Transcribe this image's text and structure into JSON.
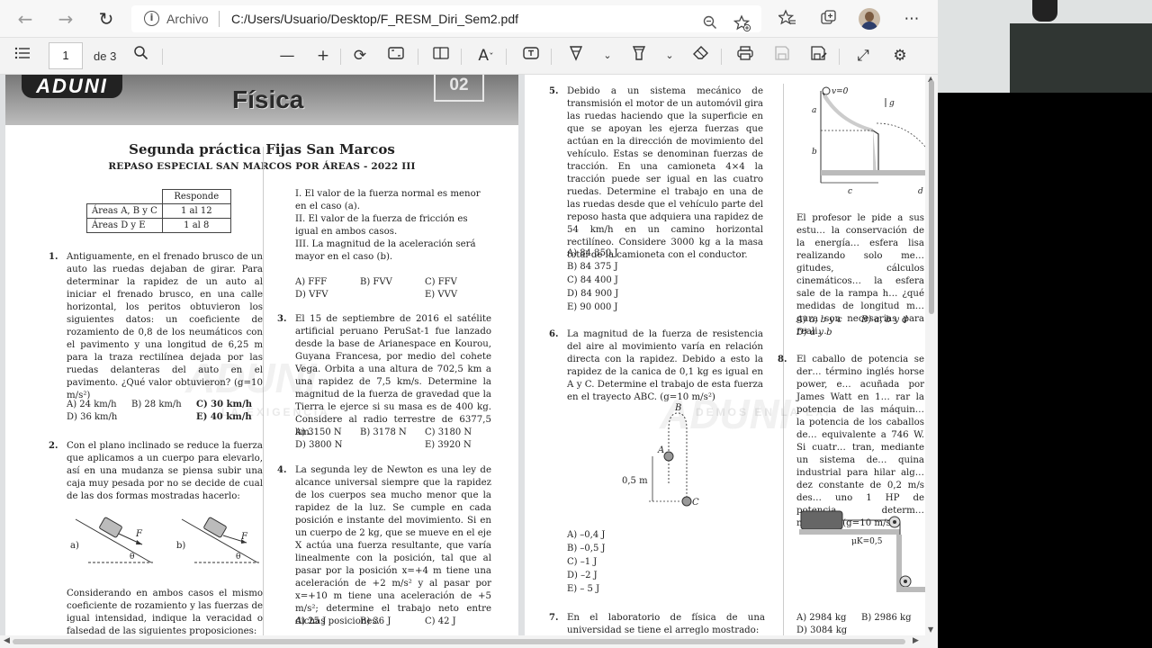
{
  "browser": {
    "site_label": "Archivo",
    "url": "C:/Users/Usuario/Desktop/F_RESM_Diri_Sem2.pdf",
    "icons": [
      "back-icon",
      "forward-icon",
      "refresh-icon",
      "info-icon",
      "zoom-icon",
      "favorite-add-icon",
      "favorites-icon",
      "collections-icon",
      "profile-avatar",
      "more-icon"
    ]
  },
  "pdf_toolbar": {
    "current_page": "1",
    "page_of": "de 3",
    "icons": [
      "contents-icon",
      "search-icon",
      "zoom-out-icon",
      "zoom-in-icon",
      "rotate-icon",
      "fit-page-icon",
      "page-view-icon",
      "read-aloud-icon",
      "text-box-icon",
      "draw-icon",
      "highlight-icon",
      "erase-icon",
      "print-icon",
      "save-icon",
      "save-as-icon",
      "fullscreen-icon",
      "settings-icon"
    ]
  },
  "page1": {
    "logo": "ADUNI",
    "banner_title": "Física",
    "banner_num": "02",
    "title": "Segunda práctica Fijas San Marcos",
    "subtitle": "REPASO ESPECIAL SAN MARCOS POR ÁREAS - 2022 III",
    "table": {
      "header": "Responde",
      "rows": [
        {
          "area": "Áreas A, B y C",
          "range": "1 al 12"
        },
        {
          "area": "Áreas D y E",
          "range": "1 al 8"
        }
      ]
    },
    "q1": {
      "num": "1.",
      "text": "Antiguamente, en el frenado brusco de un auto las ruedas dejaban de girar. Para determinar la rapidez de un auto al iniciar el frenado brusco, en una calle horizontal, los peritos obtuvieron los siguientes datos: un coeficiente de rozamiento de 0,8 de los neumáticos con el pavimento y una longitud de 6,25 m para la traza rectilínea dejada por las ruedas delanteras del auto en el pavimento. ¿Qué valor obtuvieron? (g=10 m/s²)",
      "options": [
        "A) 24 km/h",
        "B) 28 km/h",
        "C) 30 km/h",
        "D) 36 km/h",
        "E) 40 km/h"
      ]
    },
    "q2": {
      "num": "2.",
      "text": "Con el plano inclinado se reduce la fuerza que aplicamos a un cuerpo para elevarlo, así en una mudanza se piensa subir una caja muy pesada por no se decide de cual de las dos formas mostradas hacerlo:",
      "fig_labels": [
        "a)",
        "b)",
        "F",
        "F",
        "θ",
        "θ"
      ],
      "text2": "Considerando en ambos casos el mismo coeficiente de rozamiento y las fuerzas de igual intensidad, indique la veracidad o falsedad de las siguientes proposiciones:"
    },
    "statements": [
      "I. El valor de la fuerza normal es menor en el caso (a).",
      "II. El valor de la fuerza de fricción es igual en ambos casos.",
      "III. La magnitud de la aceleración será mayor en el caso (b)."
    ],
    "q2_options": [
      "A) FFF",
      "B) FVV",
      "C) FFV",
      "D) VFV",
      "E) VVV"
    ],
    "q3": {
      "num": "3.",
      "text": "El 15 de septiembre de 2016 el satélite artificial peruano PeruSat-1 fue lanzado desde la base de Arianespace en Kourou, Guyana Francesa, por medio del cohete Vega. Orbita a una altura de 702,5 km a una rapidez de 7,5 km/s. Determine la magnitud de la fuerza de gravedad que la Tierra le ejerce si su masa es de 400 kg. Considere al radio terrestre de 6377,5 km.",
      "options": [
        "A) 3150 N",
        "B) 3178 N",
        "C) 3180 N",
        "D) 3800 N",
        "E) 3920 N"
      ]
    },
    "q4": {
      "num": "4.",
      "text": "La segunda ley de Newton es una ley de alcance universal siempre que la rapidez de los cuerpos sea mucho menor que la rapidez de la luz. Se cumple en cada posición e instante del movimiento. Si en un cuerpo de 2 kg, que se mueve en el eje X actúa una fuerza resultante, que varía linealmente con la posición, tal que al pasar por la posición x=+4 m tiene una aceleración de +2 m/s² y al pasar por x=+10 m tiene una aceleración de +5 m/s²; determine el trabajo neto entre dichas posiciones.",
      "options": [
        "A) 25 J",
        "B) 36 J",
        "C) 42 J"
      ]
    },
    "watermark": "ADUNI",
    "watermark_sub": "LA EXIGENCIA"
  },
  "page2": {
    "q5": {
      "num": "5.",
      "text": "Debido a un sistema mecánico de transmisión el motor de un automóvil gira las ruedas haciendo que la superficie en que se apoyan les ejerza fuerzas que actúan en la dirección de movimiento del vehículo. Estas se denominan fuerzas de tracción. En una camioneta 4×4 la tracción puede ser igual en las cuatro ruedas. Determine el trabajo en una de las ruedas desde que el vehículo parte del reposo hasta que adquiera una rapidez de 54 km/h en un camino horizontal rectilíneo. Considere 3000 kg a la masa total de la camioneta con el conductor.",
      "options": [
        "A) 84 350 J",
        "B) 84 375 J",
        "C) 84 400 J",
        "D) 84 900 J",
        "E) 90 000 J"
      ]
    },
    "q6": {
      "num": "6.",
      "text": "La magnitud de la fuerza de resistencia del aire al movimiento varía en relación directa con la rapidez. Debido a esto la rapidez de la canica de 0,1 kg es igual en A y C. Determine el trabajo de esta fuerza en el trayecto ABC. (g=10 m/s²)",
      "fig_labels": [
        "B",
        "A",
        "C",
        "0,5 m"
      ],
      "options": [
        "A) –0,4 J",
        "B) –0,5 J",
        "C) –1 J",
        "D) –2 J",
        "E) – 5 J"
      ]
    },
    "q7": {
      "num": "7.",
      "text": "En el laboratorio de física de una universidad se tiene el arreglo mostrado:"
    },
    "q7_fig_labels": [
      "v=0",
      "g",
      "a",
      "b",
      "c",
      "d"
    ],
    "q7b_text": "El profesor le pide a sus estu… la conservación de la energía… esfera lisa realizando solo me… gitudes, cálculos cinemáticos… la esfera sale de la rampa h… ¿qué medidas de longitud m… gura son necesarias para reali…",
    "q7_options": [
      "A) a, b y c",
      "B) a, b y d",
      "D) a y b"
    ],
    "q8": {
      "num": "8.",
      "text": "El caballo de potencia se der… término inglés horse power, e… acuñada por James Watt en 1… rar la potencia de las máquin… la potencia de los caballos de… equivalente a 746 W. Si cuatr… tran, mediante un sistema de… quina industrial para hilar alg… dez constante de 0,2 m/s des… uno 1 HP de potencia, determ… máquina. (g=10 m/s²)",
      "fig_label": "μK=0,5",
      "options": [
        "A) 2984 kg",
        "B) 2986 kg",
        "D) 3084 kg"
      ]
    },
    "watermark": "ADUNI",
    "watermark_sub": "DEMOS EN LA EXI"
  }
}
